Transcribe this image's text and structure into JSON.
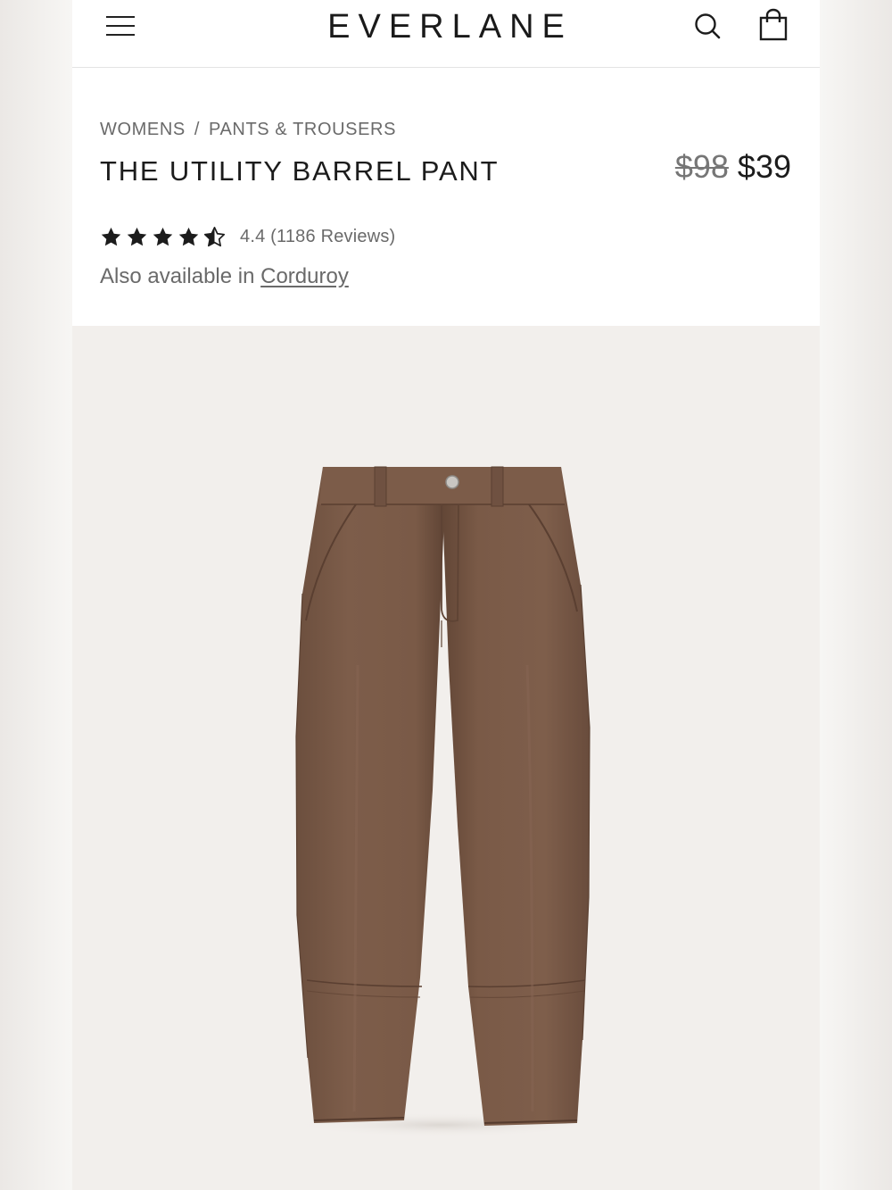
{
  "header": {
    "brand": "EVERLANE",
    "icons": {
      "menu": "menu-icon",
      "search": "search-icon",
      "bag": "shopping-bag-icon"
    }
  },
  "product": {
    "breadcrumb": [
      "WOMENS",
      "PANTS & TROUSERS"
    ],
    "breadcrumb_separator": "/",
    "title": "THE UTILITY BARREL PANT",
    "price_original": "$98",
    "price_sale": "$39",
    "rating": {
      "value": 4.4,
      "max": 5,
      "text": "4.4 (1186 Reviews)"
    },
    "also_available_prefix": "Also available in",
    "also_available_link": "Corduroy",
    "image": {
      "subject": "brown barrel-leg utility pants, front view",
      "garment_color": "#7a5a47",
      "background_color": "#f2efec"
    }
  },
  "colors": {
    "text_primary": "#1c1c1c",
    "text_secondary": "#6a6a6a",
    "divider": "#e3e3e3"
  }
}
